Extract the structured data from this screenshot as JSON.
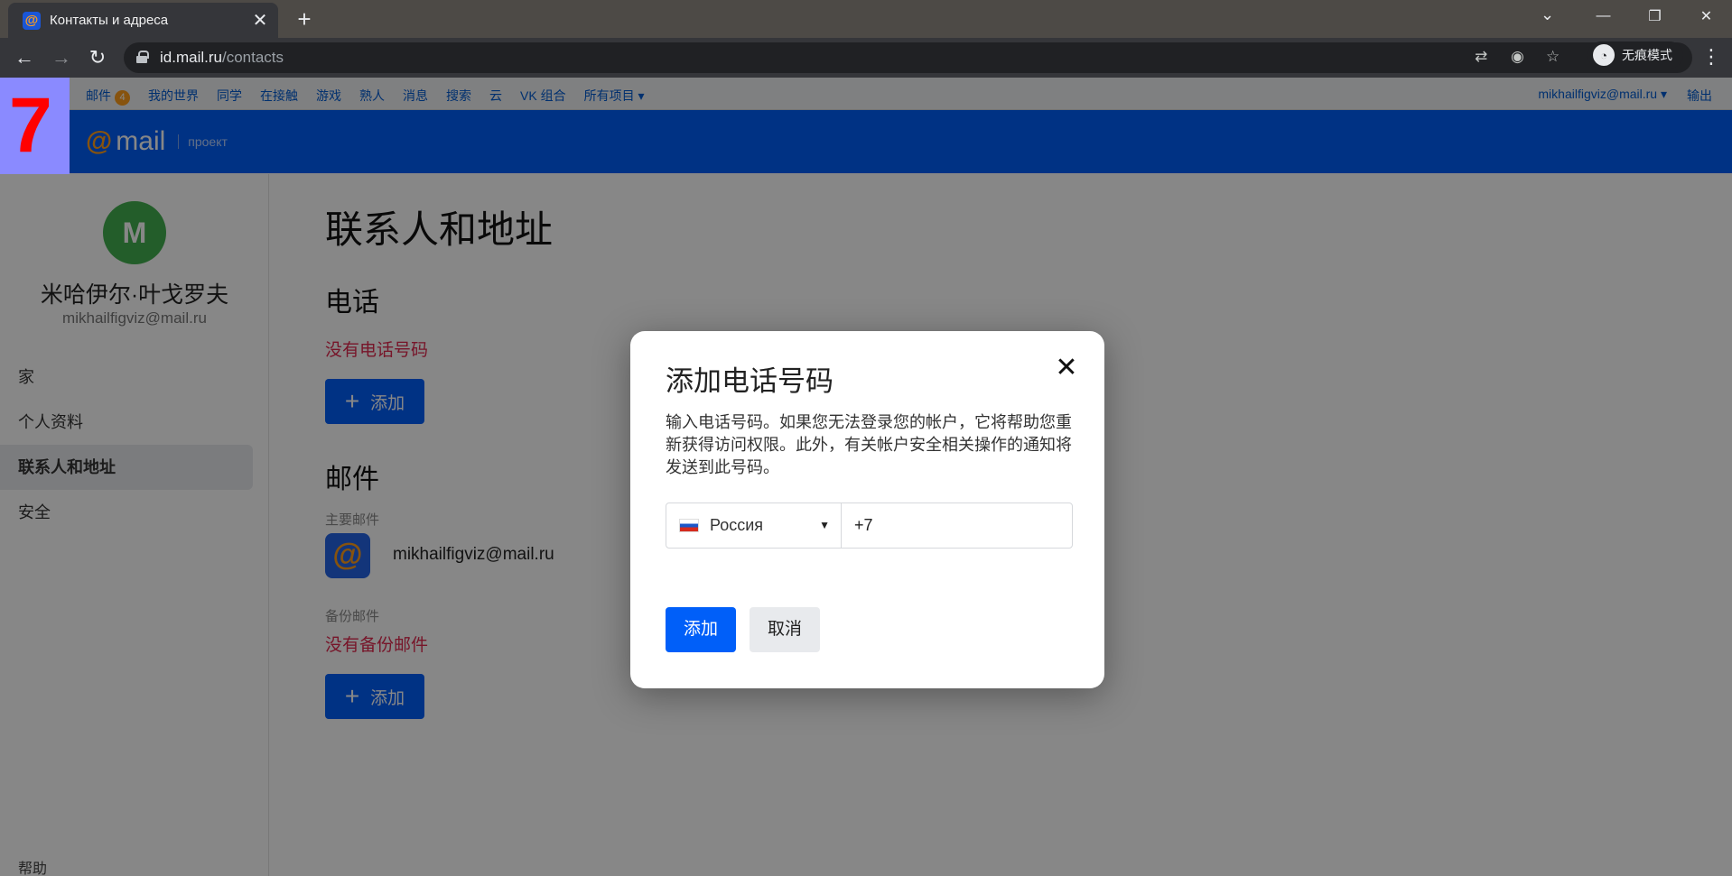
{
  "browser": {
    "tab_title": "Контакты и адреса",
    "url_domain": "id.mail.ru",
    "url_path": "/contacts",
    "incognito_label": "无痕模式"
  },
  "topnav": {
    "links": [
      "邮件",
      "我的世界",
      "同学",
      "在接触",
      "游戏",
      "熟人",
      "消息",
      "搜索",
      "云",
      "VK 组合",
      "所有项目 ▾"
    ],
    "mail_badge": "4",
    "user_email": "mikhailfigviz@mail.ru ▾",
    "logout": "输出"
  },
  "brand": {
    "logo_at": "@",
    "logo_text": "mail",
    "project_label": "проект"
  },
  "step_marker": "7",
  "sidebar": {
    "avatar_initial": "M",
    "user_name": "米哈伊尔·叶戈罗夫",
    "user_email": "mikhailfigviz@mail.ru",
    "menu": [
      "家",
      "个人资料",
      "联系人和地址",
      "安全"
    ],
    "help": "帮助"
  },
  "main": {
    "title": "联系人和地址",
    "phone_heading": "电话",
    "no_phone": "没有电话号码",
    "add_label": "添加",
    "mail_heading": "邮件",
    "primary_mail_label": "主要邮件",
    "primary_mail": "mikhailfigviz@mail.ru",
    "backup_mail_label": "备份邮件",
    "no_backup": "没有备份邮件"
  },
  "modal": {
    "title": "添加电话号码",
    "description": "输入电话号码。如果您无法登录您的帐户，它将帮助您重新获得访问权限。此外，有关帐户安全相关操作的通知将发送到此号码。",
    "country": "Россия",
    "phone_value": "+7",
    "add_button": "添加",
    "cancel_button": "取消"
  },
  "colors": {
    "brand_blue": "#005ff9",
    "accent_orange": "#ff9e1b",
    "error_red": "#e0284f"
  }
}
